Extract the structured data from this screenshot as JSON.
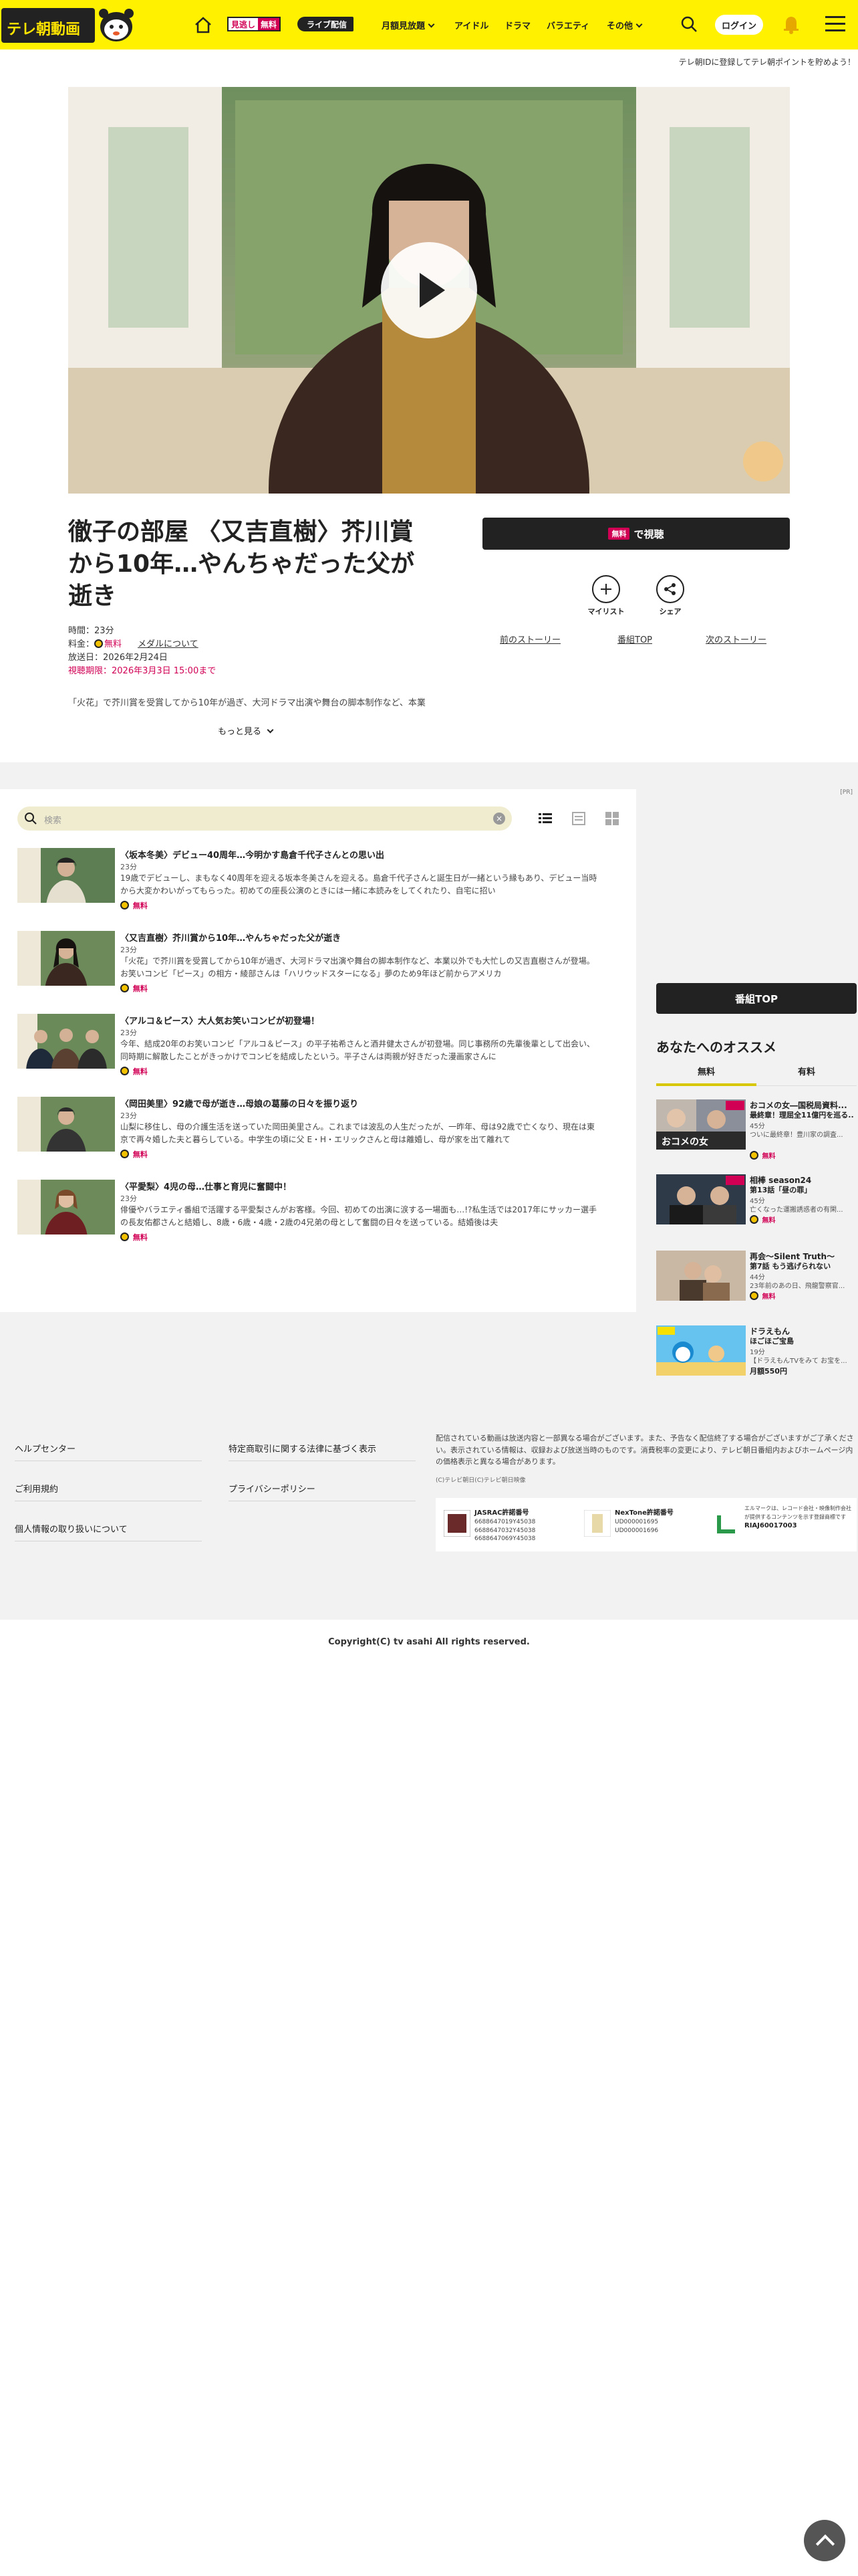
{
  "header": {
    "logo_text": "テレ朝動画",
    "nav": {
      "mitai": "見逃し",
      "mitai_free": "無料",
      "live": "ライブ配信",
      "items": [
        "月額見放題",
        "アイドル",
        "ドラマ",
        "バラエティ",
        "その他"
      ]
    },
    "login_label": "ログイン"
  },
  "promo": "テレ朝IDに登録してテレ朝ポイントを貯めよう！",
  "episode": {
    "title": "徹子の部屋 〈又吉直樹〉芥川賞から10年…やんちゃだった父が逝き",
    "duration_label": "時間：23分",
    "price_label": "料金：",
    "price_value": "無料",
    "medal_link": "メダルについて",
    "aired": "放送日：2026年2月24日",
    "period": "視聴期限：2026年3月3日 15:00まで",
    "desc_short": "「火花」で芥川賞を受賞してから10年が過ぎ、大河ドラマ出演や舞台の脚本制作など、本業",
    "more_label": "もっと見る",
    "watch_tag": "無料",
    "watch_label": "で視聴",
    "mylist_label": "マイリスト",
    "share_label": "シェア",
    "prev_story": "前のストーリー",
    "prog_top": "番組TOP",
    "next_story": "次のストーリー"
  },
  "list": {
    "ad_note": "[PR]",
    "search_placeholder": "検索",
    "clear": "×",
    "items": [
      {
        "name": "〈坂本冬美〉デビュー40周年…今明かす島倉千代子さんとの思い出",
        "dur": "23分",
        "desc": "19歳でデビューし、まもなく40周年を迎える坂本冬美さんを迎える。島倉千代子さんと誕生日が一緒という縁もあり、デビュー当時から大変かわいがってもらった。初めての座長公演のときには一緒に本読みをしてくれたり、自宅に招い",
        "free": "無料"
      },
      {
        "name": "〈又吉直樹〉芥川賞から10年…やんちゃだった父が逝き",
        "dur": "23分",
        "desc": "「火花」で芥川賞を受賞してから10年が過ぎ、大河ドラマ出演や舞台の脚本制作など、本業以外でも大忙しの又吉直樹さんが登場。お笑いコンビ「ピース」の相方・綾部さんは「ハリウッドスターになる」夢のため9年ほど前からアメリカ",
        "free": "無料"
      },
      {
        "name": "〈アルコ＆ピース〉大人気お笑いコンビが初登場！",
        "dur": "23分",
        "desc": "今年、結成20年のお笑いコンビ「アルコ＆ピース」の平子祐希さんと酒井健太さんが初登場。同じ事務所の先輩後輩として出会い、同時期に解散したことがきっかけでコンビを結成したという。平子さんは両親が好きだった漫画家さんに",
        "free": "無料"
      },
      {
        "name": "〈岡田美里〉92歳で母が逝き…母娘の葛藤の日々を振り返り",
        "dur": "23分",
        "desc": "山梨に移住し、母の介護生活を送っていた岡田美里さん。これまでは波乱の人生だったが、一昨年、母は92歳で亡くなり、現在は東京で再々婚した夫と暮らしている。中学生の頃に父 E・H・エリックさんと母は離婚し、母が家を出て離れて",
        "free": "無料"
      },
      {
        "name": "〈平愛梨〉4児の母…仕事と育児に奮闘中！",
        "dur": "23分",
        "desc": "俳優やバラエティ番組で活躍する平愛梨さんがお客様。今回、初めての出演に涙する一場面も…!?私生活では2017年にサッカー選手の長友佑都さんと結婚し、8歳・6歳・4歳・2歳の4兄弟の母として奮闘の日々を送っている。結婚後は夫",
        "free": "無料"
      }
    ]
  },
  "sidebar": {
    "prog_top": "番組TOP",
    "rec_title": "あなたへのオススメ",
    "tab_free": "無料",
    "tab_paid": "有料",
    "items": [
      {
        "name": "おコメの女―国税局資料...",
        "sub": "最終章！理屈全11億円を巡る...",
        "dur": "45分",
        "desc": "ついに最終章！豊川家の調査...",
        "badge": "無料",
        "paid": false
      },
      {
        "name": "相棒 season24",
        "sub": "第13話「昼の罪」",
        "dur": "45分",
        "desc": "亡くなった運搬誘惑者の有閑...",
        "badge": "無料",
        "paid": false
      },
      {
        "name": "再会～Silent Truth～",
        "sub": "第7話 もう逃げられない",
        "dur": "44分",
        "desc": "23年前のあの日、飛龍警察官...",
        "badge": "無料",
        "paid": false
      },
      {
        "name": "ドラえもん",
        "sub": "ほごほご宝島",
        "dur": "19分",
        "desc": "【ドラえもんTVをみて お宝を...",
        "badge": "月額550円",
        "paid": true
      }
    ]
  },
  "footer": {
    "links_col1": [
      "ヘルプセンター",
      "ご利用規約",
      "個人情報の取り扱いについて"
    ],
    "links_col2": [
      "特定商取引に関する法律に基づく表示",
      "プライバシーポリシー"
    ],
    "note": "配信されている動画は放送内容と一部異なる場合がございます。また、予告なく配信終了する場合がございますがご了承ください。表示されている情報は、収録および放送当時のものです。消費税率の変更により、テレビ朝日番組内およびホームページ内の価格表示と異なる場合があります。",
    "small_copy": "(C)テレビ朝日(C)テレビ朝日映像",
    "jasrac_title": "JASRAC許諾番号",
    "jasrac_nums": "6688647019Y45038\n6688647032Y45038\n6688647069Y45038",
    "nextone_title": "NexTone許諾番号",
    "nextone_nums": "UD000001695\nUD000001696",
    "riaj_text": "エルマークは、レコード会社・映像制作会社が提供するコンテンツを示す登録商標です",
    "riaj_num": "RIAJ60017003",
    "copyright": "Copyright(C) tv asahi All rights reserved."
  }
}
